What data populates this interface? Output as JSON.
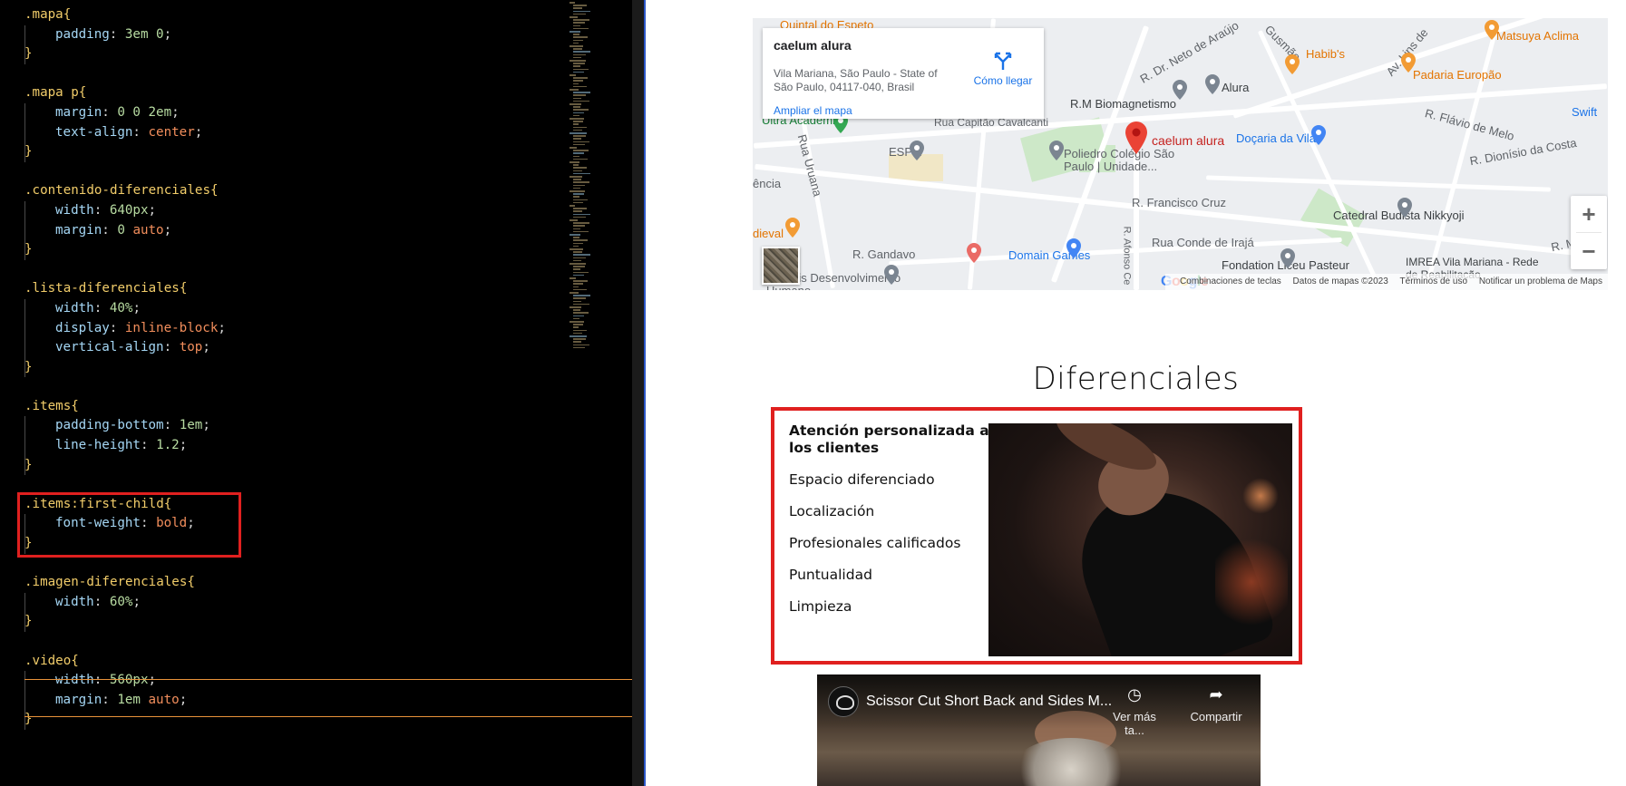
{
  "editor": {
    "lines": [
      [
        {
          "t": ".mapa{",
          "c": "sel"
        }
      ],
      [
        {
          "i": 1
        },
        {
          "t": "padding",
          "c": "prop"
        },
        {
          "t": ": ",
          "c": "dim"
        },
        {
          "t": "3em 0",
          "c": "num"
        },
        {
          "t": ";",
          "c": "dim"
        }
      ],
      [
        {
          "t": "}",
          "c": "pn"
        }
      ],
      [],
      [
        {
          "t": ".mapa p{",
          "c": "sel"
        }
      ],
      [
        {
          "i": 1
        },
        {
          "t": "margin",
          "c": "prop"
        },
        {
          "t": ": ",
          "c": "dim"
        },
        {
          "t": "0 0 2em",
          "c": "num"
        },
        {
          "t": ";",
          "c": "dim"
        }
      ],
      [
        {
          "i": 1
        },
        {
          "t": "text-align",
          "c": "prop"
        },
        {
          "t": ": ",
          "c": "dim"
        },
        {
          "t": "center",
          "c": "kw"
        },
        {
          "t": ";",
          "c": "dim"
        }
      ],
      [
        {
          "t": "}",
          "c": "pn"
        }
      ],
      [],
      [
        {
          "t": ".contenido-diferenciales{",
          "c": "sel"
        }
      ],
      [
        {
          "i": 1
        },
        {
          "t": "width",
          "c": "prop"
        },
        {
          "t": ": ",
          "c": "dim"
        },
        {
          "t": "640px",
          "c": "num"
        },
        {
          "t": ";",
          "c": "dim"
        }
      ],
      [
        {
          "i": 1
        },
        {
          "t": "margin",
          "c": "prop"
        },
        {
          "t": ": ",
          "c": "dim"
        },
        {
          "t": "0 ",
          "c": "num"
        },
        {
          "t": "auto",
          "c": "kw"
        },
        {
          "t": ";",
          "c": "dim"
        }
      ],
      [
        {
          "t": "}",
          "c": "pn"
        }
      ],
      [],
      [
        {
          "t": ".lista-diferenciales{",
          "c": "sel"
        }
      ],
      [
        {
          "i": 1
        },
        {
          "t": "width",
          "c": "prop"
        },
        {
          "t": ": ",
          "c": "dim"
        },
        {
          "t": "40%",
          "c": "num"
        },
        {
          "t": ";",
          "c": "dim"
        }
      ],
      [
        {
          "i": 1
        },
        {
          "t": "display",
          "c": "prop"
        },
        {
          "t": ": ",
          "c": "dim"
        },
        {
          "t": "inline-block",
          "c": "kw"
        },
        {
          "t": ";",
          "c": "dim"
        }
      ],
      [
        {
          "i": 1
        },
        {
          "t": "vertical-align",
          "c": "prop"
        },
        {
          "t": ": ",
          "c": "dim"
        },
        {
          "t": "top",
          "c": "kw"
        },
        {
          "t": ";",
          "c": "dim"
        }
      ],
      [
        {
          "t": "}",
          "c": "pn"
        }
      ],
      [],
      [
        {
          "t": ".items{",
          "c": "sel"
        }
      ],
      [
        {
          "i": 1
        },
        {
          "t": "padding-bottom",
          "c": "prop"
        },
        {
          "t": ": ",
          "c": "dim"
        },
        {
          "t": "1em",
          "c": "num"
        },
        {
          "t": ";",
          "c": "dim"
        }
      ],
      [
        {
          "i": 1
        },
        {
          "t": "line-height",
          "c": "prop"
        },
        {
          "t": ": ",
          "c": "dim"
        },
        {
          "t": "1.2",
          "c": "num"
        },
        {
          "t": ";",
          "c": "dim"
        }
      ],
      [
        {
          "t": "}",
          "c": "pn"
        }
      ],
      [],
      [
        {
          "t": ".items:first-child{",
          "c": "sel"
        }
      ],
      [
        {
          "i": 1
        },
        {
          "t": "font-weight",
          "c": "prop"
        },
        {
          "t": ": ",
          "c": "dim"
        },
        {
          "t": "bold",
          "c": "kw"
        },
        {
          "t": ";",
          "c": "dim"
        }
      ],
      [
        {
          "t": "}",
          "c": "pn"
        }
      ],
      [],
      [
        {
          "t": ".imagen-diferenciales{",
          "c": "sel"
        }
      ],
      [
        {
          "i": 1
        },
        {
          "t": "width",
          "c": "prop"
        },
        {
          "t": ": ",
          "c": "dim"
        },
        {
          "t": "60%",
          "c": "num"
        },
        {
          "t": ";",
          "c": "dim"
        }
      ],
      [
        {
          "t": "}",
          "c": "pn"
        }
      ],
      [],
      [
        {
          "t": ".video{",
          "c": "sel"
        }
      ],
      [
        {
          "i": 1
        },
        {
          "t": "width",
          "c": "prop"
        },
        {
          "t": ": ",
          "c": "dim"
        },
        {
          "t": "560px",
          "c": "num"
        },
        {
          "t": ";",
          "c": "dim"
        }
      ],
      [
        {
          "i": 1
        },
        {
          "t": "margin",
          "c": "prop"
        },
        {
          "t": ": ",
          "c": "dim"
        },
        {
          "t": "1em ",
          "c": "num"
        },
        {
          "t": "auto",
          "c": "kw"
        },
        {
          "t": ";",
          "c": "dim"
        }
      ],
      [
        {
          "t": "}",
          "c": "pn"
        }
      ]
    ],
    "highlight_color": "#e0201f",
    "focus_line_color": "#e8923a"
  },
  "map": {
    "place_title": "caelum alura",
    "address": "Vila Mariana, São Paulo - State of São Paulo, 04117-040, Brasil",
    "directions_label": "Cómo llegar",
    "larger_map_label": "Ampliar el mapa",
    "pin_label": "caelum alura",
    "labels": {
      "quintal": "Quintal do Espeto",
      "neto": "R. Dr. Neto de Araújo",
      "gusmao": "Gusmão",
      "habibs": "Habib's",
      "lins": "Av. Lins de",
      "matsuya": "Matsuya Aclima",
      "alura": "Alura",
      "padaria": "Padaria Europão",
      "biomag": "R.M Biomagnetismo",
      "ultra": "Ultra Academia",
      "capitao": "Rua Capitão Cavalcanti",
      "flavio": "R. Flávio de Melo",
      "swift": "Swift",
      "docaria": "Doçaria da Vila",
      "dionisio": "R. Dionísio da Costa",
      "espm": "ESPM",
      "poliedro": "Poliedro Colégio São Paulo | Unidade...",
      "francisco": "R. Francisco Cruz",
      "uruana": "Rua Uruana",
      "cia": "ência",
      "catedral": "Catedral Budista Nikkyoji",
      "dieval": "dieval",
      "conde": "Rua Conde de Irajá",
      "gandavo": "R. Gandavo",
      "domain": "Domain Games",
      "afonso": "R. Afonso Ce",
      "liceu": "Fondation Liceu Pasteur",
      "imrea": "IMREA Vila Mariana - Rede de Reabilitação",
      "monte": "R. Monte",
      "modulus": "Modulis Desenvolvimento Humano"
    },
    "google": "Google",
    "attribution": [
      "Combinaciones de teclas",
      "Datos de mapas ©2023",
      "Términos de uso",
      "Notificar un problema de Maps"
    ],
    "zoom_in": "+",
    "zoom_out": "−"
  },
  "diferenciales": {
    "title": "Diferenciales",
    "items": [
      "Atención personalizada a los clientes",
      "Espacio diferenciado",
      "Localización",
      "Profesionales calificados",
      "Puntualidad",
      "Limpieza"
    ]
  },
  "video": {
    "title": "Scissor Cut Short Back and Sides M...",
    "watch_later": "Ver más ta...",
    "share": "Compartir"
  }
}
